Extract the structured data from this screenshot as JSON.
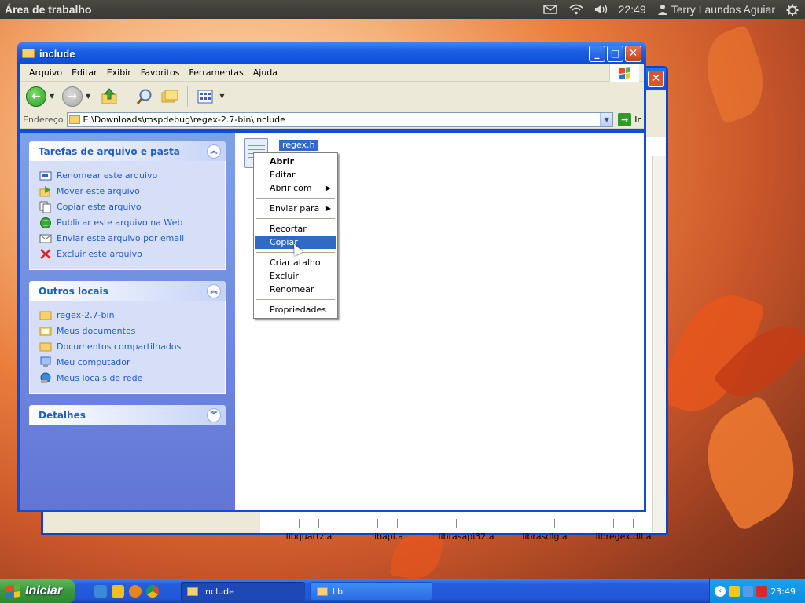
{
  "topbar": {
    "title": "Área de trabalho",
    "time": "22:49",
    "user": "Terry Laundos Aguiar"
  },
  "window": {
    "title": "include",
    "menu": [
      "Arquivo",
      "Editar",
      "Exibir",
      "Favoritos",
      "Ferramentas",
      "Ajuda"
    ],
    "address_label": "Endereço",
    "address_value": "E:\\Downloads\\mspdebug\\regex-2.7-bin\\include",
    "go_label": "Ir"
  },
  "taskpane": {
    "tasks": {
      "title": "Tarefas de arquivo e pasta",
      "items": [
        "Renomear este arquivo",
        "Mover este arquivo",
        "Copiar este arquivo",
        "Publicar este arquivo na Web",
        "Enviar este arquivo por email",
        "Excluir este arquivo"
      ]
    },
    "places": {
      "title": "Outros locais",
      "items": [
        "regex-2.7-bin",
        "Meus documentos",
        "Documentos compartilhados",
        "Meu computador",
        "Meus locais de rede"
      ]
    },
    "details": {
      "title": "Detalhes"
    }
  },
  "content": {
    "file_name": "regex.h"
  },
  "context_menu": {
    "open": "Abrir",
    "edit": "Editar",
    "open_with": "Abrir com",
    "send_to": "Enviar para",
    "cut": "Recortar",
    "copy": "Copiar",
    "shortcut": "Criar atalho",
    "delete": "Excluir",
    "rename": "Renomear",
    "properties": "Propriedades"
  },
  "bg_window": {
    "files": [
      "libquartz.a",
      "libapi.a",
      "librasapi32.a",
      "librasdlg.a",
      "libregex.dll.a"
    ]
  },
  "taskbar": {
    "start": "Iniciar",
    "tasks": [
      "include",
      "lib"
    ],
    "clock": "23:49"
  }
}
